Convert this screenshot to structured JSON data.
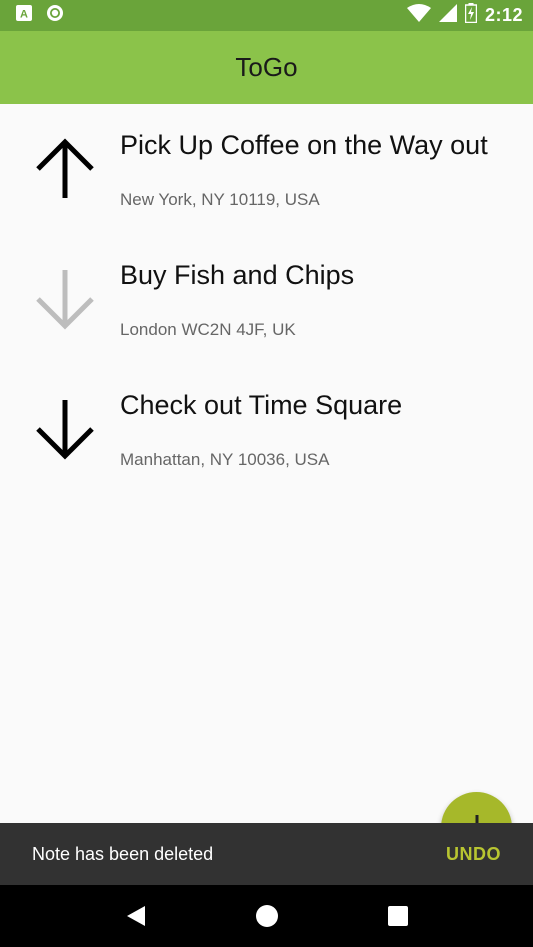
{
  "status_bar": {
    "time": "2:12",
    "icons": [
      "a-notification-icon",
      "circle-notification-icon",
      "wifi-icon",
      "cell-signal-icon",
      "battery-charging-icon"
    ]
  },
  "toolbar": {
    "title": "ToGo"
  },
  "notes": [
    {
      "title": "Pick Up Coffee on the Way out",
      "address": "New York, NY 10119, USA",
      "icon": "arrow-up-icon",
      "color": "#000000"
    },
    {
      "title": "Buy Fish and Chips",
      "address": "London WC2N 4JF, UK",
      "icon": "arrow-down-icon",
      "color": "#bdbdbd"
    },
    {
      "title": "Check out Time Square",
      "address": "Manhattan, NY 10036, USA",
      "icon": "arrow-down-icon",
      "color": "#000000"
    }
  ],
  "fab": {
    "icon": "plus-icon",
    "color": "#a6b82a"
  },
  "snackbar": {
    "message": "Note has been deleted",
    "action": "UNDO",
    "action_color": "#b8c531"
  },
  "nav_bar": {
    "icons": [
      "back-icon",
      "home-icon",
      "recents-icon"
    ]
  },
  "colors": {
    "primary": "#8bc34a",
    "primary_dark": "#6aa43a"
  }
}
